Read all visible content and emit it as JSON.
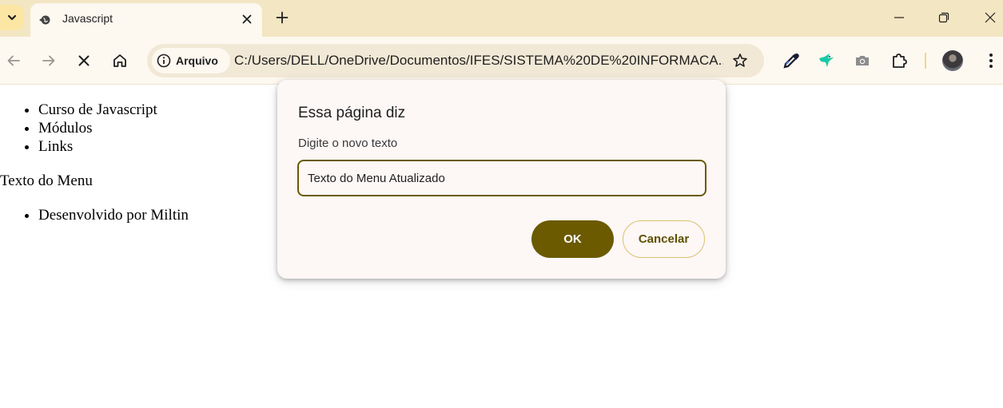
{
  "browser": {
    "tab": {
      "title": "Javascript"
    },
    "toolbar": {
      "site_chip_label": "Arquivo",
      "url": "C:/Users/DELL/OneDrive/Documentos/IFES/SISTEMA%20DE%20INFORMACA..."
    },
    "icons": {
      "tab_search": "chevron-down-icon",
      "favicon": "globe-icon",
      "tab_close": "close-icon",
      "new_tab": "plus-icon",
      "back": "arrow-left-icon",
      "forward": "arrow-right-icon",
      "stop": "close-icon",
      "home": "home-icon",
      "info": "info-icon",
      "bookmark": "star-icon",
      "extensions": [
        "eyedropper-icon",
        "bird-icon",
        "camera-icon",
        "puzzle-icon"
      ],
      "menu": "kebab-icon"
    },
    "colors": {
      "tabstrip": "#f3e6c3",
      "toolbar": "#fdf8f0",
      "accent": "#6b5a00"
    }
  },
  "page": {
    "menu_items": [
      "Curso de Javascript",
      "Módulos",
      "Links"
    ],
    "menu_text": "Texto do Menu",
    "footer_items": [
      "Desenvolvido por Miltin"
    ]
  },
  "dialog": {
    "title": "Essa página diz",
    "message": "Digite o novo texto",
    "input_value": "Texto do Menu Atualizado",
    "ok_label": "OK",
    "cancel_label": "Cancelar"
  }
}
